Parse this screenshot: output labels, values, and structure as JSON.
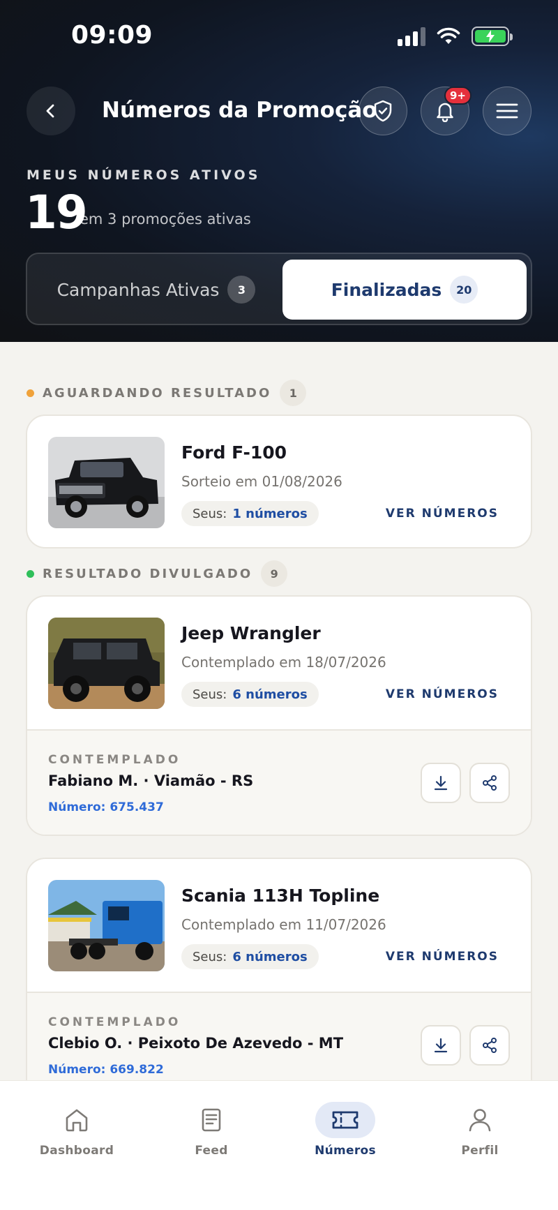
{
  "status_bar": {
    "time": "09:09"
  },
  "header": {
    "title": "Números da Promoção",
    "notification_badge": "9+",
    "eyebrow": "MEUS NÚMEROS ATIVOS",
    "active_count": "19",
    "active_subtitle": "em 3 promoções ativas"
  },
  "tabs": [
    {
      "label": "Campanhas Ativas",
      "count": "3",
      "selected": false
    },
    {
      "label": "Finalizadas",
      "count": "20",
      "selected": true
    }
  ],
  "groups": {
    "awaiting": {
      "label": "AGUARDANDO RESULTADO",
      "count": "1",
      "dot_color": "#f0a23a"
    },
    "published": {
      "label": "RESULTADO DIVULGADO",
      "count": "9",
      "dot_color": "#2fbf5a"
    }
  },
  "cards": [
    {
      "title": "Ford F-100",
      "date": "Sorteio em 01/08/2026",
      "seus_label": "Seus:",
      "seus_value": "1 números",
      "link": "VER NÚMEROS"
    },
    {
      "title": "Jeep Wrangler",
      "date": "Contemplado em 18/07/2026",
      "seus_label": "Seus:",
      "seus_value": "6 números",
      "link": "VER NÚMEROS",
      "winner": {
        "eyebrow": "CONTEMPLADO",
        "name": "Fabiano M. · Viamão - RS",
        "number": "Número: 675.437"
      }
    },
    {
      "title": "Scania 113H Topline",
      "date": "Contemplado em 11/07/2026",
      "seus_label": "Seus:",
      "seus_value": "6 números",
      "link": "VER NÚMEROS",
      "winner": {
        "eyebrow": "CONTEMPLADO",
        "name": "Clebio O. · Peixoto De Azevedo - MT",
        "number": "Número: 669.822"
      }
    }
  ],
  "bottom_nav": [
    {
      "label": "Dashboard",
      "icon": "home-icon",
      "active": false
    },
    {
      "label": "Feed",
      "icon": "document-icon",
      "active": false
    },
    {
      "label": "Números",
      "icon": "ticket-icon",
      "active": true
    },
    {
      "label": "Perfil",
      "icon": "user-icon",
      "active": false
    }
  ],
  "colors": {
    "accent": "#1e3a6e",
    "link_blue": "#2f6bd8",
    "badge_red": "#e5303c",
    "battery_green": "#3ad35a"
  }
}
